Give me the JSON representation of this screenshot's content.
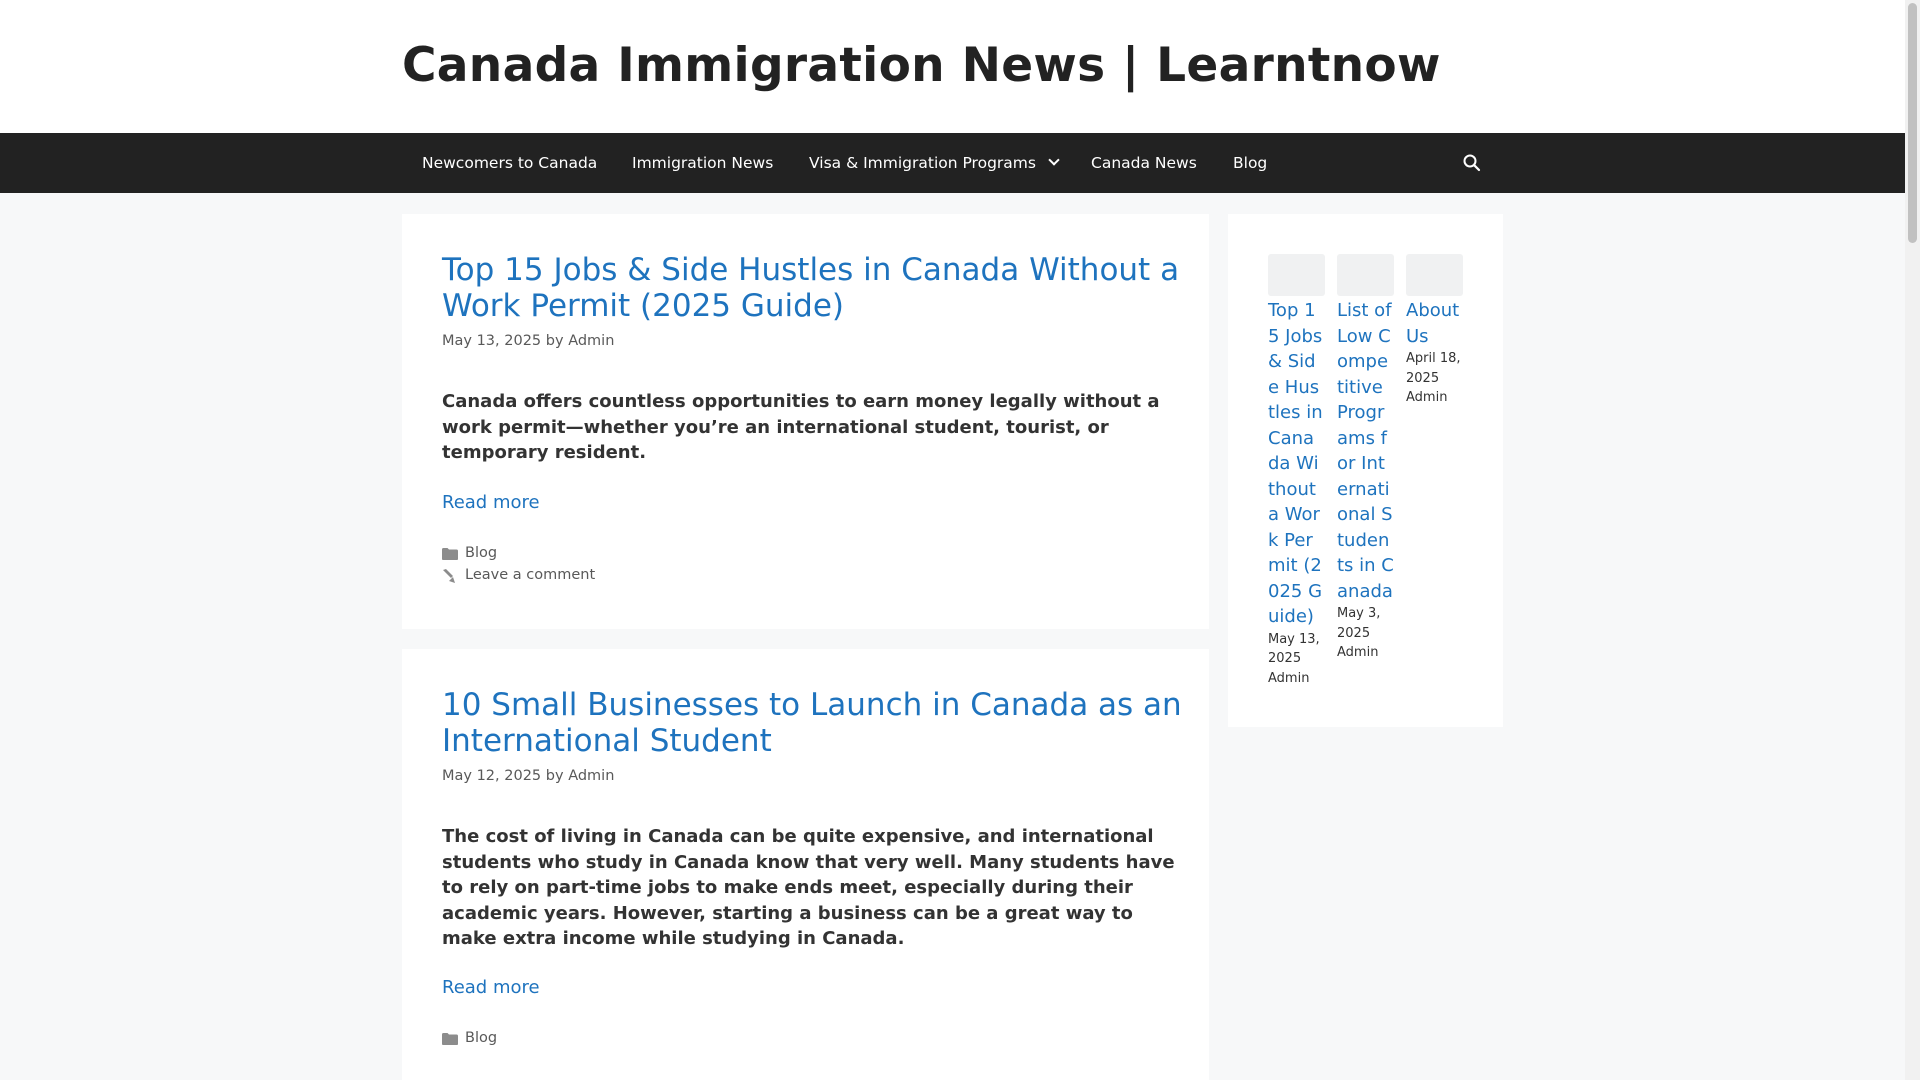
{
  "site": {
    "title": "Canada Immigration News | Learntnow"
  },
  "nav": {
    "items": [
      {
        "label": "Newcomers to Canada"
      },
      {
        "label": "Immigration News"
      },
      {
        "label": "Visa & Immigration Programs"
      },
      {
        "label": "Canada News"
      },
      {
        "label": "Blog"
      }
    ],
    "search_icon": "search-icon"
  },
  "posts": [
    {
      "title": "Top 15 Jobs & Side Hustles in Canada Without a Work Permit (2025 Guide)",
      "date": "May 13, 2025",
      "by": "by",
      "author": "Admin",
      "excerpt": "Canada offers countless opportunities to earn money legally without a work permit—whether you’re an international student, tourist, or temporary resident.",
      "read_more": "Read more",
      "category": "Blog",
      "comment": "Leave a comment"
    },
    {
      "title": "10 Small Businesses to Launch in Canada as an International Student",
      "date": "May 12, 2025",
      "by": "by",
      "author": "Admin",
      "excerpt": "The cost of living in Canada can be quite expensive, and international students who study in Canada know that very well. Many students have to rely on part-time jobs to make ends meet, especially during their academic years. However, starting a business can be a great way to make extra income while studying in Canada.",
      "read_more": "Read more",
      "category": "Blog"
    }
  ],
  "sidebar": {
    "recent": [
      {
        "title": "Top 15 Jobs & Side Hustles in Canada Without a Work Permit (2025 Guide)",
        "date": "May 13, 2025",
        "author": "Admin"
      },
      {
        "title": "List of Low Competitive Programs for International Students in Canada",
        "date": "May 3, 2025",
        "author": "Admin"
      },
      {
        "title": "About Us",
        "date": "April 18, 2025",
        "author": "Admin"
      }
    ]
  },
  "colors": {
    "link": "#1e73be",
    "nav_bg": "#222222",
    "page_bg": "#f7f8f9"
  }
}
